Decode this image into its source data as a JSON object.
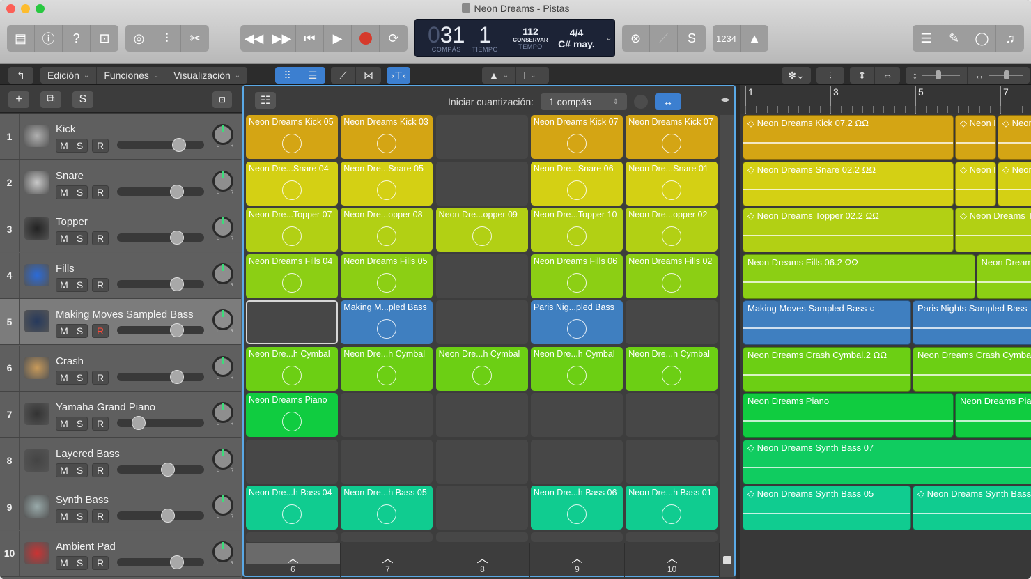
{
  "window": {
    "title": "Neon Dreams - Pistas"
  },
  "toolbar": {
    "left_group": [
      "library-icon",
      "info-icon",
      "help-icon",
      "smart-controls-icon"
    ],
    "edit_group": [
      "tuner-dial-icon",
      "mixer-icon",
      "scissors-icon"
    ],
    "transport": [
      "rewind-icon",
      "fast-forward-icon",
      "go-to-start-icon",
      "play-icon",
      "record-icon",
      "cycle-icon"
    ],
    "lcd": {
      "bar_prefix": "0",
      "bar": "31",
      "beat": "1",
      "bar_label": "COMPÁS",
      "beat_label": "TIEMPO",
      "tempo": "112",
      "tempo_mode": "CONSERVAR",
      "tempo_label": "TEMPO",
      "time_signature": "4/4",
      "key": "C# may."
    },
    "right_group1": [
      "replace-icon",
      "tuner-fork-icon",
      "solo-icon"
    ],
    "count_in": "1234",
    "right_group2": [
      "list-editors-icon",
      "notepad-icon",
      "loop-browser-icon",
      "media-browser-icon"
    ]
  },
  "controlbar": {
    "back_icon": "↰",
    "menus": [
      "Edición",
      "Funciones",
      "Visualización"
    ],
    "pointer_tool": "▲",
    "text_tool": "I"
  },
  "track_header": {
    "add": "+",
    "dup": "⧉",
    "solo": "S"
  },
  "tracks": [
    {
      "num": "1",
      "name": "Kick",
      "volume": 0.75,
      "record_armed": false,
      "icon": "kick-drum-icon",
      "color": "#b0b0b0"
    },
    {
      "num": "2",
      "name": "Snare",
      "volume": 0.72,
      "record_armed": false,
      "icon": "snare-drum-icon",
      "color": "#c9c9c9"
    },
    {
      "num": "3",
      "name": "Topper",
      "volume": 0.72,
      "record_armed": false,
      "icon": "drum-pad-icon",
      "color": "#222"
    },
    {
      "num": "4",
      "name": "Fills",
      "volume": 0.72,
      "record_armed": false,
      "icon": "tom-drum-icon",
      "color": "#2b6bd9"
    },
    {
      "num": "5",
      "name": "Making Moves Sampled Bass",
      "volume": 0.72,
      "record_armed": true,
      "icon": "waveform-icon",
      "color": "#26395c"
    },
    {
      "num": "6",
      "name": "Crash",
      "volume": 0.72,
      "record_armed": false,
      "icon": "cymbal-icon",
      "color": "#c89a5a"
    },
    {
      "num": "7",
      "name": "Yamaha Grand Piano",
      "volume": 0.2,
      "record_armed": false,
      "icon": "grand-piano-icon",
      "color": "#333"
    },
    {
      "num": "8",
      "name": "Layered Bass",
      "volume": 0.6,
      "record_armed": false,
      "icon": "synth-keyboard-icon",
      "color": "#444"
    },
    {
      "num": "9",
      "name": "Synth Bass",
      "volume": 0.6,
      "record_armed": false,
      "icon": "keyboard-stand-icon",
      "color": "#9aa"
    },
    {
      "num": "10",
      "name": "Ambient Pad",
      "volume": 0.72,
      "record_armed": false,
      "icon": "red-keyboard-icon",
      "color": "#c33"
    }
  ],
  "live_loops": {
    "quantize_label": "Iniciar cuantización:",
    "quantize_value": "1 compás",
    "columns": [
      "6",
      "7",
      "8",
      "9",
      "10"
    ],
    "rows": [
      {
        "color": "#d4a514",
        "cells": [
          "Neon Dreams Kick 05",
          "Neon Dreams Kick 03",
          "",
          "Neon Dreams Kick 07",
          "Neon Dreams Kick 07"
        ]
      },
      {
        "color": "#d4d014",
        "cells": [
          "Neon Dre...Snare 04",
          "Neon Dre...Snare 05",
          "",
          "Neon Dre...Snare 06",
          "Neon Dre...Snare 01"
        ]
      },
      {
        "color": "#b2d014",
        "cells": [
          "Neon Dre...Topper 07",
          "Neon Dre...opper 08",
          "Neon Dre...opper 09",
          "Neon Dre...Topper 10",
          "Neon Dre...opper 02"
        ]
      },
      {
        "color": "#8ccf14",
        "cells": [
          "Neon Dreams Fills 04",
          "Neon Dreams Fills 05",
          "",
          "Neon Dreams Fills 06",
          "Neon Dreams Fills 02"
        ]
      },
      {
        "color": "#3f7fc0",
        "cells": [
          "",
          "Making M...pled Bass",
          "",
          "Paris Nig...pled Bass",
          ""
        ]
      },
      {
        "color": "#6ccf14",
        "cells": [
          "Neon Dre...h Cymbal",
          "Neon Dre...h Cymbal",
          "Neon Dre...h Cymbal",
          "Neon Dre...h Cymbal",
          "Neon Dre...h Cymbal"
        ]
      },
      {
        "color": "#10cc40",
        "cells": [
          "Neon Dreams Piano",
          "",
          "",
          "",
          ""
        ]
      },
      {
        "color": "#10cc70",
        "cells": [
          "",
          "",
          "",
          "",
          ""
        ]
      },
      {
        "color": "#10cc90",
        "cells": [
          "Neon Dre...h Bass 04",
          "Neon Dre...h Bass 05",
          "",
          "Neon Dre...h Bass 06",
          "Neon Dre...h Bass 01"
        ]
      }
    ]
  },
  "ruler": {
    "bars": [
      "1",
      "3",
      "5",
      "7"
    ]
  },
  "regions": [
    [
      {
        "name": "◇ Neon Dreams Kick 07.2  ΩΩ",
        "start": 0,
        "len": 5.0,
        "color": "#d4a514"
      },
      {
        "name": "◇ Neon D",
        "start": 5.0,
        "len": 1.0,
        "color": "#d4a514"
      },
      {
        "name": "◇ Neon",
        "start": 6.0,
        "len": 1.0,
        "color": "#d4a514"
      }
    ],
    [
      {
        "name": "◇ Neon Dreams Snare 02.2  ΩΩ",
        "start": 0,
        "len": 5.0,
        "color": "#d4d014"
      },
      {
        "name": "◇ Neon D",
        "start": 5.0,
        "len": 1.0,
        "color": "#d4d014"
      },
      {
        "name": "◇ Neon",
        "start": 6.0,
        "len": 1.0,
        "color": "#d4d014"
      }
    ],
    [
      {
        "name": "◇ Neon Dreams Topper 02.2  ΩΩ",
        "start": 0,
        "len": 5.0,
        "color": "#b2d014"
      },
      {
        "name": "◇ Neon Dreams T",
        "start": 5.0,
        "len": 2.0,
        "color": "#b2d014"
      }
    ],
    [
      {
        "name": "Neon Dreams Fills 06.2  ΩΩ",
        "start": 0,
        "len": 5.5,
        "color": "#8ccf14"
      },
      {
        "name": "Neon Dream",
        "start": 5.5,
        "len": 1.5,
        "color": "#8ccf14"
      }
    ],
    [
      {
        "name": "Making Moves Sampled Bass  ○",
        "start": 0,
        "len": 4.0,
        "color": "#3f7fc0"
      },
      {
        "name": "Paris Nights Sampled Bass",
        "start": 4.0,
        "len": 3.0,
        "color": "#3f7fc0"
      }
    ],
    [
      {
        "name": "Neon Dreams Crash Cymbal.2  ΩΩ",
        "start": 0,
        "len": 4.0,
        "color": "#6ccf14"
      },
      {
        "name": "Neon Dreams Crash Cymbal",
        "start": 4.0,
        "len": 3.0,
        "color": "#6ccf14"
      }
    ],
    [
      {
        "name": "Neon Dreams Piano",
        "start": 0,
        "len": 5.0,
        "color": "#10cc40"
      },
      {
        "name": "Neon Dreams Pia",
        "start": 5.0,
        "len": 2.0,
        "color": "#10cc40"
      }
    ],
    [
      {
        "name": "◇ Neon Dreams Synth Bass 07",
        "start": 0,
        "len": 7.0,
        "color": "#10cc60"
      }
    ],
    [
      {
        "name": "◇ Neon Dreams Synth Bass 05",
        "start": 0,
        "len": 4.0,
        "color": "#10cc90"
      },
      {
        "name": "◇ Neon Dreams Synth Bass",
        "start": 4.0,
        "len": 3.0,
        "color": "#10cc90"
      }
    ],
    []
  ]
}
